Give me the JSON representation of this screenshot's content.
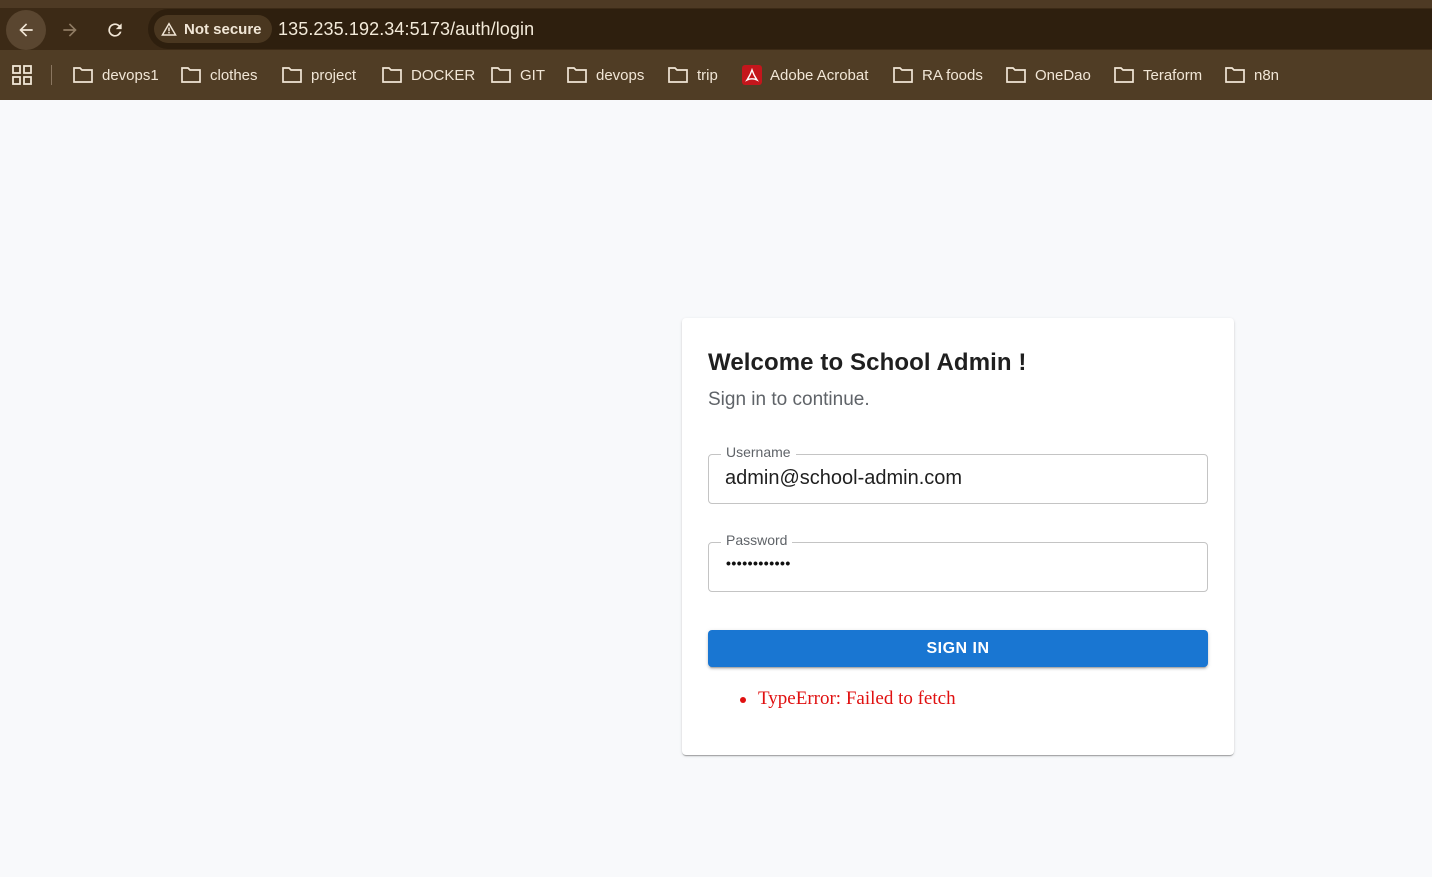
{
  "browser": {
    "security_label": "Not secure",
    "url": "135.235.192.34:5173/auth/login",
    "bookmarks": [
      {
        "label": "devops1",
        "icon": "folder-icon"
      },
      {
        "label": "clothes",
        "icon": "folder-icon"
      },
      {
        "label": "project",
        "icon": "folder-icon"
      },
      {
        "label": "DOCKER",
        "icon": "folder-icon"
      },
      {
        "label": "GIT",
        "icon": "folder-icon"
      },
      {
        "label": "devops",
        "icon": "folder-icon"
      },
      {
        "label": "trip",
        "icon": "folder-icon"
      },
      {
        "label": "Adobe Acrobat",
        "icon": "adobe-acrobat-icon"
      },
      {
        "label": "RA foods",
        "icon": "folder-icon"
      },
      {
        "label": "OneDao",
        "icon": "folder-icon"
      },
      {
        "label": "Teraform",
        "icon": "folder-icon"
      },
      {
        "label": "n8n",
        "icon": "folder-icon"
      }
    ]
  },
  "login": {
    "title": "Welcome to School Admin !",
    "subtitle": "Sign in to continue.",
    "username_label": "Username",
    "username_value": "admin@school-admin.com",
    "password_label": "Password",
    "password_mask": "••••••••••••",
    "signin_label": "SIGN IN",
    "errors": [
      "TypeError: Failed to fetch"
    ]
  },
  "colors": {
    "primary": "#1976d2",
    "error": "#e01010",
    "toolbar": "#3c2a16",
    "bookmark_bar": "#503d25"
  }
}
